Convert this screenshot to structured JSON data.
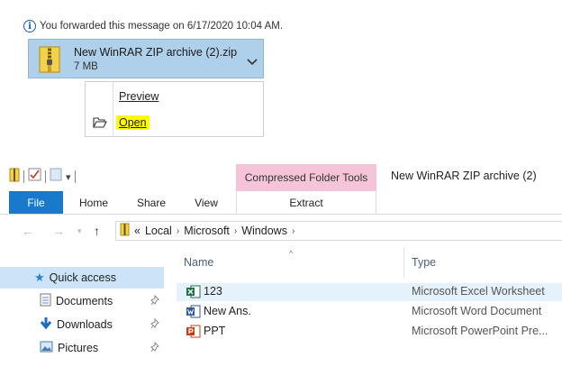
{
  "outlook": {
    "info_text": "You forwarded this message on 6/17/2020 10:04 AM.",
    "attachment": {
      "name": "New WinRAR ZIP archive (2).zip",
      "size": "7 MB"
    },
    "menu": {
      "preview_label": "Preview",
      "open_label": "Open"
    },
    "highlight_color": "#ffff00"
  },
  "explorer": {
    "title": "New WinRAR ZIP archive (2)",
    "contextual_group": "Compressed Folder Tools",
    "tabs": [
      "File",
      "Home",
      "Share",
      "View",
      "Extract"
    ],
    "breadcrumb": [
      "Local",
      "Microsoft",
      "Windows"
    ],
    "breadcrumb_overflow": "«",
    "sidebar": [
      {
        "label": "Quick access",
        "icon": "star-icon"
      },
      {
        "label": "Documents",
        "icon": "documents-icon"
      },
      {
        "label": "Downloads",
        "icon": "downloads-icon"
      },
      {
        "label": "Pictures",
        "icon": "pictures-icon"
      }
    ],
    "columns": {
      "name": "Name",
      "type": "Type"
    },
    "files": [
      {
        "name": "123",
        "type": "Microsoft Excel Worksheet",
        "icon": "excel-icon"
      },
      {
        "name": "New Ans.",
        "type": "Microsoft Word Document",
        "icon": "word-icon"
      },
      {
        "name": "PPT",
        "type": "Microsoft PowerPoint Pre...",
        "icon": "powerpoint-icon"
      }
    ],
    "colors": {
      "file_tab": "#1979ca",
      "contextual_tab": "#f6c4d8",
      "selection": "#cce4f7"
    }
  }
}
